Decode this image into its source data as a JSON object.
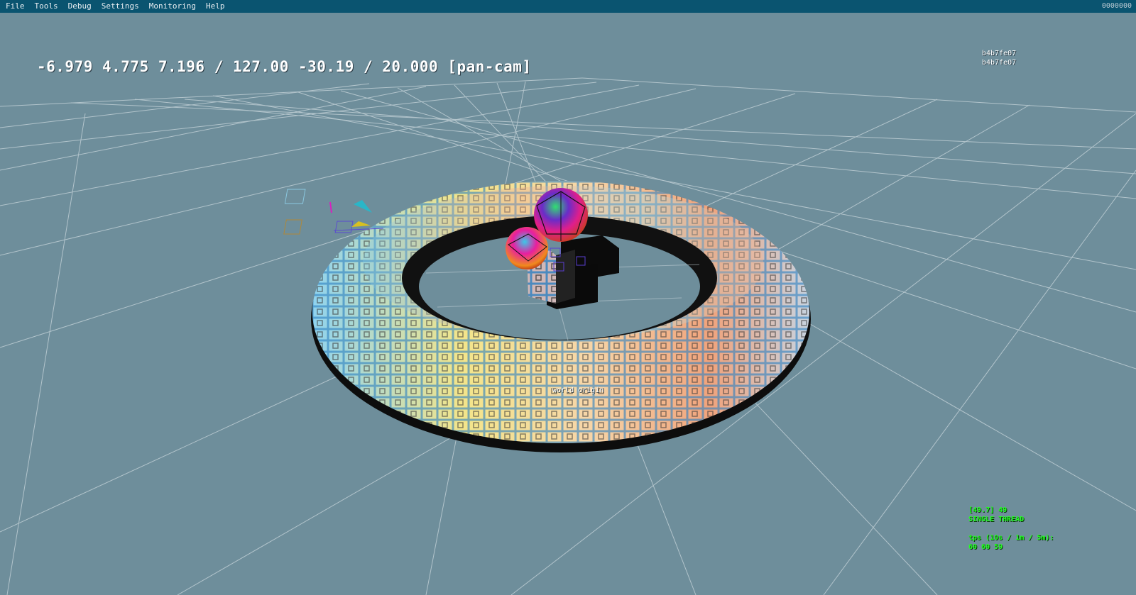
{
  "menu": {
    "items": [
      "File",
      "Tools",
      "Debug",
      "Settings",
      "Monitoring",
      "Help"
    ],
    "counter": "0000000"
  },
  "hud": {
    "camera_readout": "-6.979 4.775 7.196 / 127.00 -30.19 / 20.000 [pan-cam]",
    "hash_1": "b4b7fe07",
    "hash_2": "b4b7fe07",
    "world_origin_label": "world origin",
    "perf": {
      "fps_line": "[49.7] 49",
      "thread_mode": "SINGLE THREAD",
      "tps_header": "tps (10s / 1m / 5m):",
      "tps_values": "60 60 59"
    }
  },
  "scene": {
    "background_color": "#6e8e9b",
    "grid_color": "#c9d6dc",
    "menubar_color": "#0a5470",
    "objects": [
      "grid-floor",
      "torus",
      "sphere",
      "sphere",
      "cube",
      "cube",
      "camera-gizmo"
    ]
  }
}
